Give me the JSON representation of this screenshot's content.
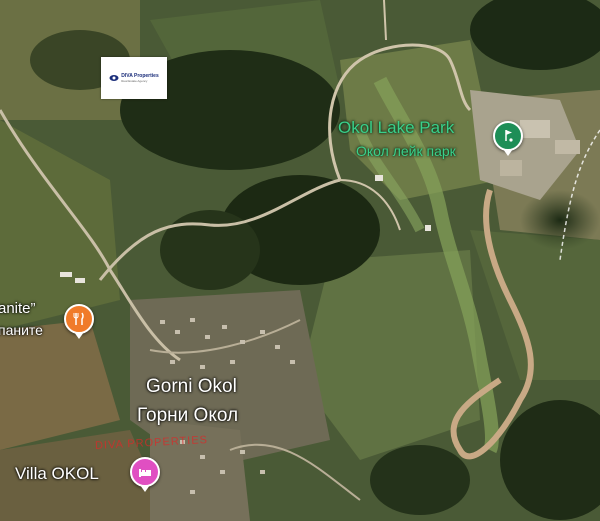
{
  "map": {
    "places": {
      "okol_lake_park": {
        "name_en": "Okol Lake Park",
        "name_bg": "Окол лейк парк",
        "icon": "golf-icon",
        "color": "#1e8e57"
      },
      "gorni_okol": {
        "name_en": "Gorni Okol",
        "name_bg": "Горни Окол"
      },
      "restaurant": {
        "name_en": "anite”",
        "name_bg": "паните",
        "icon": "restaurant-icon",
        "color": "#f07b2a"
      },
      "villa_okol": {
        "name_en": "Villa OKOL",
        "icon": "hotel-icon",
        "color": "#e04fc2"
      }
    },
    "logo": {
      "title": "DIVA Properties",
      "subtitle": "Real Estate Agency"
    },
    "watermark": "DIVA PROPERTIES"
  }
}
